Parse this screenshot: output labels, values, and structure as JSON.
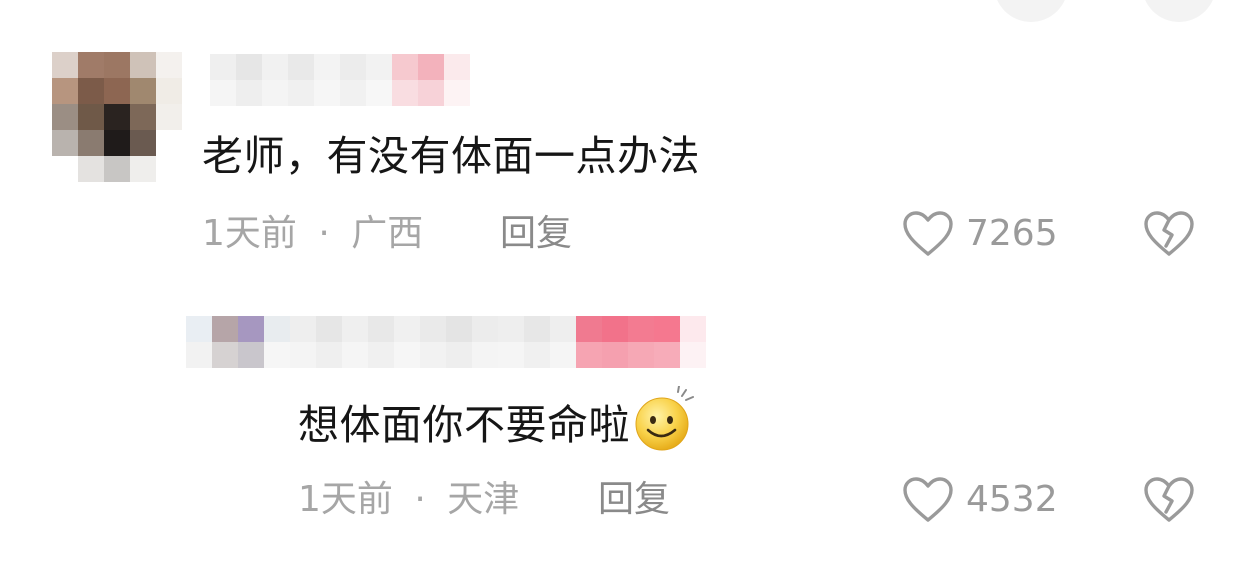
{
  "comments": [
    {
      "text": "老师，有没有体面一点办法",
      "time": "1天前",
      "separator": "·",
      "location": "广西",
      "reply_label": "回复",
      "likes": "7265"
    },
    {
      "text": "想体面你不要命啦",
      "emoji": "smile-emoji",
      "time": "1天前",
      "separator": "·",
      "location": "天津",
      "reply_label": "回复",
      "likes": "4532"
    }
  ],
  "colors": {
    "text": "#161616",
    "meta": "#a6a6a6",
    "reply": "#8a8a8a",
    "icon": "#9a9a9a",
    "username_badge": "#f47a90"
  },
  "icons": [
    "heart-outline-icon",
    "broken-heart-icon",
    "smile-emoji"
  ]
}
